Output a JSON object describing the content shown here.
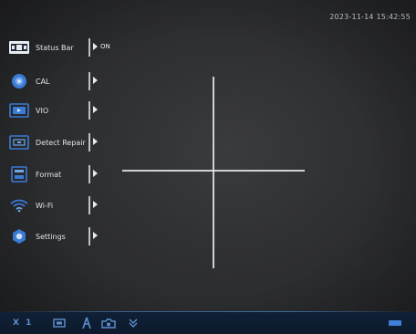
{
  "timestamp": "2023-11-14 15:42:55",
  "menu": {
    "items": [
      {
        "label": "Status Bar",
        "icon": "status-bar-icon",
        "value": "ON"
      },
      {
        "label": "CAL",
        "icon": "calibrate-icon",
        "value": ""
      },
      {
        "label": "VIO",
        "icon": "video-icon",
        "value": ""
      },
      {
        "label": "Detect Repair",
        "icon": "detect-repair-icon",
        "value": ""
      },
      {
        "label": "Format",
        "icon": "format-icon",
        "value": ""
      },
      {
        "label": "Wi-Fi",
        "icon": "wifi-icon",
        "value": ""
      },
      {
        "label": "Settings",
        "icon": "settings-icon",
        "value": ""
      }
    ]
  },
  "bottom_bar": {
    "zoom": "X 1",
    "icons": [
      "screen-icon",
      "person-icon",
      "camera-icon",
      "chevron-down-icon",
      "battery-icon"
    ]
  },
  "colors": {
    "accent": "#3f7fd6",
    "bottom_bar": "#0d1a2c",
    "menu_icon_blue": "#3a7bd5"
  }
}
